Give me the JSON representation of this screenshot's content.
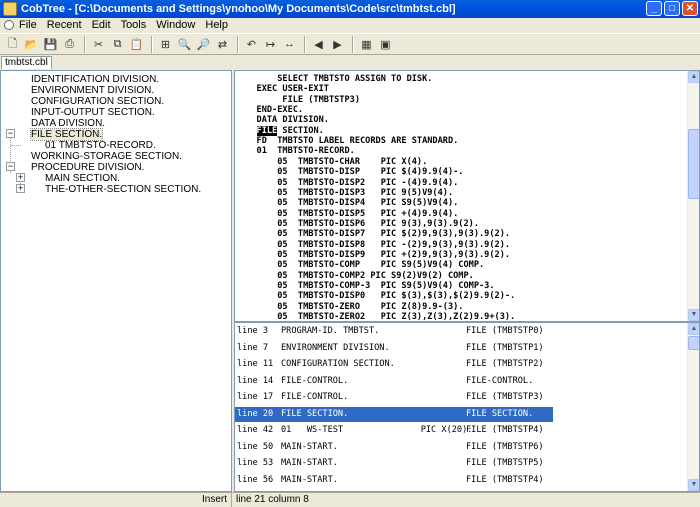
{
  "window": {
    "title": "CobTree - [C:\\Documents and Settings\\ynohoo\\My Documents\\Code\\src\\tmbtst.cbl]",
    "minimize": "_",
    "maximize": "□",
    "close": "✕"
  },
  "menu": [
    {
      "label": "File"
    },
    {
      "label": "Recent"
    },
    {
      "label": "Edit"
    },
    {
      "label": "Tools"
    },
    {
      "label": "Window"
    },
    {
      "label": "Help"
    }
  ],
  "toolbar": {
    "icons": [
      {
        "name": "new-file-icon",
        "glyph": "🗋"
      },
      {
        "name": "open-folder-icon",
        "glyph": "📂"
      },
      {
        "name": "save-icon",
        "glyph": "💾"
      },
      {
        "name": "print-icon",
        "glyph": "⎙"
      },
      {
        "name": "cut-icon",
        "glyph": "✂"
      },
      {
        "name": "copy-icon",
        "glyph": "⧉"
      },
      {
        "name": "paste-icon",
        "glyph": "📋"
      },
      {
        "name": "tree-view-icon",
        "glyph": "⊞"
      },
      {
        "name": "find-icon",
        "glyph": "🔍"
      },
      {
        "name": "find-next-icon",
        "glyph": "🔎"
      },
      {
        "name": "replace-icon",
        "glyph": "⇄"
      },
      {
        "name": "undo-icon",
        "glyph": "↶"
      },
      {
        "name": "goto-icon",
        "glyph": "↦"
      },
      {
        "name": "range-icon",
        "glyph": "↔"
      },
      {
        "name": "back-icon",
        "glyph": "◀"
      },
      {
        "name": "forward-icon",
        "glyph": "▶"
      },
      {
        "name": "calculator-icon",
        "glyph": "▦"
      },
      {
        "name": "window-icon",
        "glyph": "▣"
      }
    ]
  },
  "tab": {
    "label": "tmbtst.cbl"
  },
  "tree": {
    "items": [
      {
        "label": "IDENTIFICATION DIVISION.",
        "level": 1,
        "expander": ""
      },
      {
        "label": "ENVIRONMENT DIVISION.",
        "level": 1,
        "expander": ""
      },
      {
        "label": "CONFIGURATION SECTION.",
        "level": 1,
        "expander": ""
      },
      {
        "label": "INPUT-OUTPUT SECTION.",
        "level": 1,
        "expander": ""
      },
      {
        "label": "DATA DIVISION.",
        "level": 1,
        "expander": ""
      },
      {
        "label": "FILE SECTION.",
        "level": 1,
        "expander": "−",
        "selected": true
      },
      {
        "label": "01   TMBTSTO-RECORD.",
        "level": 2,
        "expander": ""
      },
      {
        "label": "WORKING-STORAGE SECTION.",
        "level": 1,
        "expander": ""
      },
      {
        "label": "PROCEDURE DIVISION.",
        "level": 1,
        "expander": "−"
      },
      {
        "label": "MAIN SECTION.",
        "level": 2,
        "expander": "+"
      },
      {
        "label": "THE-OTHER-SECTION SECTION.",
        "level": 2,
        "expander": "+"
      }
    ]
  },
  "editor": {
    "lines": [
      "       SELECT TMBTSTO ASSIGN TO DISK.",
      "   EXEC USER-EXIT",
      "        FILE (TMBTSTP3)",
      "   END-EXEC.",
      "   DATA DIVISION.",
      "   |FILE| SECTION.",
      "   FD  TMBTSTO LABEL RECORDS ARE STANDARD.",
      "   01  TMBTSTO-RECORD.",
      "       05  TMBTSTO-CHAR    PIC X(4).",
      "       05  TMBTSTO-DISP    PIC $(4)9.9(4)-.",
      "       05  TMBTSTO-DISP2   PIC -(4)9.9(4).",
      "       05  TMBTSTO-DISP3   PIC 9(5)V9(4).",
      "       05  TMBTSTO-DISP4   PIC S9(5)V9(4).",
      "       05  TMBTSTO-DISP5   PIC +(4)9.9(4).",
      "       05  TMBTSTO-DISP6   PIC 9(3),9(3).9(2).",
      "       05  TMBTSTO-DISP7   PIC $(2)9,9(3),9(3).9(2).",
      "       05  TMBTSTO-DISP8   PIC -(2)9,9(3),9(3).9(2).",
      "       05  TMBTSTO-DISP9   PIC +(2)9,9(3),9(3).9(2).",
      "       05  TMBTSTO-COMP    PIC S9(5)V9(4) COMP.",
      "       05  TMBTSTO-COMP2 PIC S9(2)V9(2) COMP.",
      "       05  TMBTSTO-COMP-3  PIC S9(5)V9(4) COMP-3.",
      "       05  TMBTSTO-DISP0   PIC $(3),$(3),$(2)9.9(2)-.",
      "       05  TMBTSTO-ZERO    PIC Z(8)9.9-(3).",
      "       05  TMBTSTO-ZERO2   PIC Z(3),Z(3),Z(2)9.9+(3)."
    ]
  },
  "results": {
    "rows": [
      {
        "line": "line 3",
        "text": "PROGRAM-ID. TMBTST.",
        "file": "FILE (TMBTSTP0)"
      },
      {
        "line": "line 7",
        "text": "ENVIRONMENT DIVISION.",
        "file": "FILE (TMBTSTP1)"
      },
      {
        "line": "line 11",
        "text": "CONFIGURATION SECTION.",
        "file": "FILE (TMBTSTP2)"
      },
      {
        "line": "line 14",
        "text": "FILE-CONTROL.",
        "file": "FILE-CONTROL."
      },
      {
        "line": "line 17",
        "text": "FILE-CONTROL.",
        "file": "FILE (TMBTSTP3)"
      },
      {
        "line": "line 20",
        "text": "FILE SECTION.",
        "file": "FILE SECTION.",
        "selected": true
      },
      {
        "line": "line 42",
        "text": "01   WS-TEST               PIC X(20).",
        "file": "FILE (TMBTSTP4)"
      },
      {
        "line": "line 50",
        "text": "MAIN-START.",
        "file": "FILE (TMBTSTP6)"
      },
      {
        "line": "line 53",
        "text": "MAIN-START.",
        "file": "FILE (TMBTSTP5)"
      },
      {
        "line": "line 56",
        "text": "MAIN-START.",
        "file": "FILE (TMBTSTP4)"
      }
    ]
  },
  "status": {
    "mode": "Insert",
    "position": "line 21 column 8"
  },
  "colors": {
    "titlebar": "#0054e3",
    "selection": "#316ac5",
    "chrome": "#ece9d8"
  }
}
